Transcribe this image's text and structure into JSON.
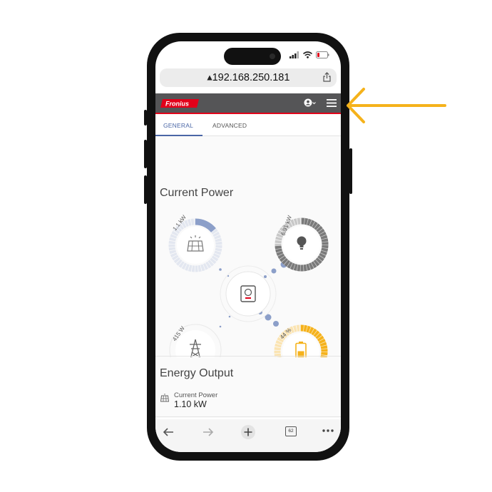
{
  "browser": {
    "url": "192.168.250.181",
    "toolbar": {
      "back": "back-arrow",
      "forward": "forward-arrow",
      "new_tab": "plus",
      "tab_count": "62",
      "more": "ellipsis"
    }
  },
  "app": {
    "brand": "Fronius",
    "header_icons": [
      "user-icon",
      "hamburger-menu-icon"
    ],
    "tabs": [
      {
        "label": "GENERAL",
        "active": true
      },
      {
        "label": "ADVANCED",
        "active": false
      }
    ]
  },
  "current_power": {
    "title": "Current Power",
    "nodes": {
      "solar": {
        "label": "1.1 kW",
        "icon": "solar-panel-icon",
        "fill_fraction": 0.14,
        "color": "#8c9fc9"
      },
      "load": {
        "label": "6.91 kW",
        "icon": "lightbulb-icon",
        "fill_fraction": 0.75,
        "color": "#7a7a7a"
      },
      "grid": {
        "label": "415 W",
        "icon": "power-pylon-icon"
      },
      "battery": {
        "label": "44 %",
        "icon": "battery-icon",
        "fill_fraction": 0.44,
        "color": "#f5b21b"
      },
      "inverter": {
        "icon": "inverter-icon"
      }
    }
  },
  "energy_output": {
    "title": "Energy Output",
    "items": [
      {
        "label": "Current Power",
        "value": "1.10 kW",
        "icon": "solar-panel-icon"
      }
    ]
  },
  "annotation": {
    "icon": "arrow-left-icon",
    "color": "#f5b21b"
  }
}
